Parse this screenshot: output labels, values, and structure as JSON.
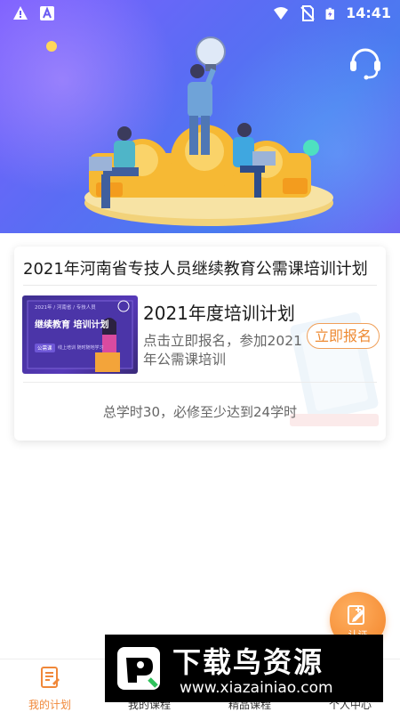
{
  "status_bar": {
    "time": "14:41",
    "left_icons": [
      "warning-icon",
      "a-badge-icon"
    ],
    "right_icons": [
      "wifi-icon",
      "no-sim-icon",
      "battery-charging-icon"
    ]
  },
  "header": {
    "support_icon": "headset-icon"
  },
  "plan_card": {
    "title": "2021年河南省专技人员继续教育公需课培训计划",
    "thumbnail": {
      "top_line": "2021年 / 河南省 / 专技人员",
      "main_text": "继续教育 培训计划",
      "badge": "公需课",
      "footer_text": "线上培训 随时随地学习"
    },
    "plan_name": "2021年度培训计划",
    "description": "点击立即报名，参加2021年公需课培训",
    "signup_label": "立即报名",
    "hours_text": "总学时30，必修至少达到24学时"
  },
  "fab": {
    "label": "认证",
    "icon": "edit-plus-icon"
  },
  "bottom_nav": {
    "items": [
      {
        "label": "我的计划",
        "icon": "plan-doc-icon",
        "active": true
      },
      {
        "label": "我的课程",
        "icon": "course-icon",
        "active": false
      },
      {
        "label": "精品课程",
        "icon": "featured-icon",
        "active": false
      },
      {
        "label": "个人中心",
        "icon": "person-icon",
        "active": false
      }
    ]
  },
  "watermark": {
    "title": "下载鸟资源",
    "url": "www.xiazainiao.com"
  },
  "colors": {
    "accent": "#f0883a",
    "hero_start": "#7d5fff",
    "hero_end": "#4a7bf0"
  }
}
